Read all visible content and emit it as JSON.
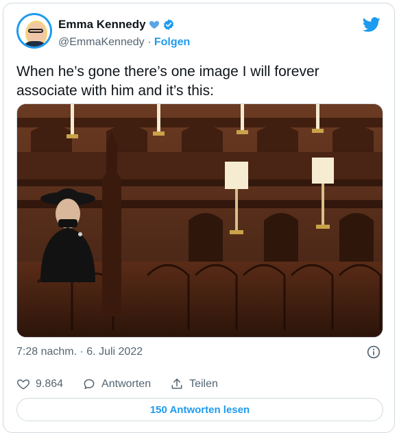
{
  "author": {
    "display_name": "Emma Kennedy",
    "handle": "@EmmaKennedy",
    "separator": "·",
    "follow_label": "Folgen",
    "heart_color": "#5ba4e6",
    "verified_color": "#1d9bf0"
  },
  "brand": {
    "logo_icon": "twitter-bird-icon",
    "color": "#1d9bf0"
  },
  "tweet": {
    "text": "When he’s gone there’s one image I will forever associate with him and it’s this:"
  },
  "meta": {
    "timestamp": "7:28 nachm. · 6. Juli 2022",
    "info_icon": "info-circle-icon"
  },
  "actions": {
    "like_count": "9.864",
    "reply_label": "Antworten",
    "share_label": "Teilen"
  },
  "footer": {
    "read_replies_label": "150 Antworten lesen"
  }
}
